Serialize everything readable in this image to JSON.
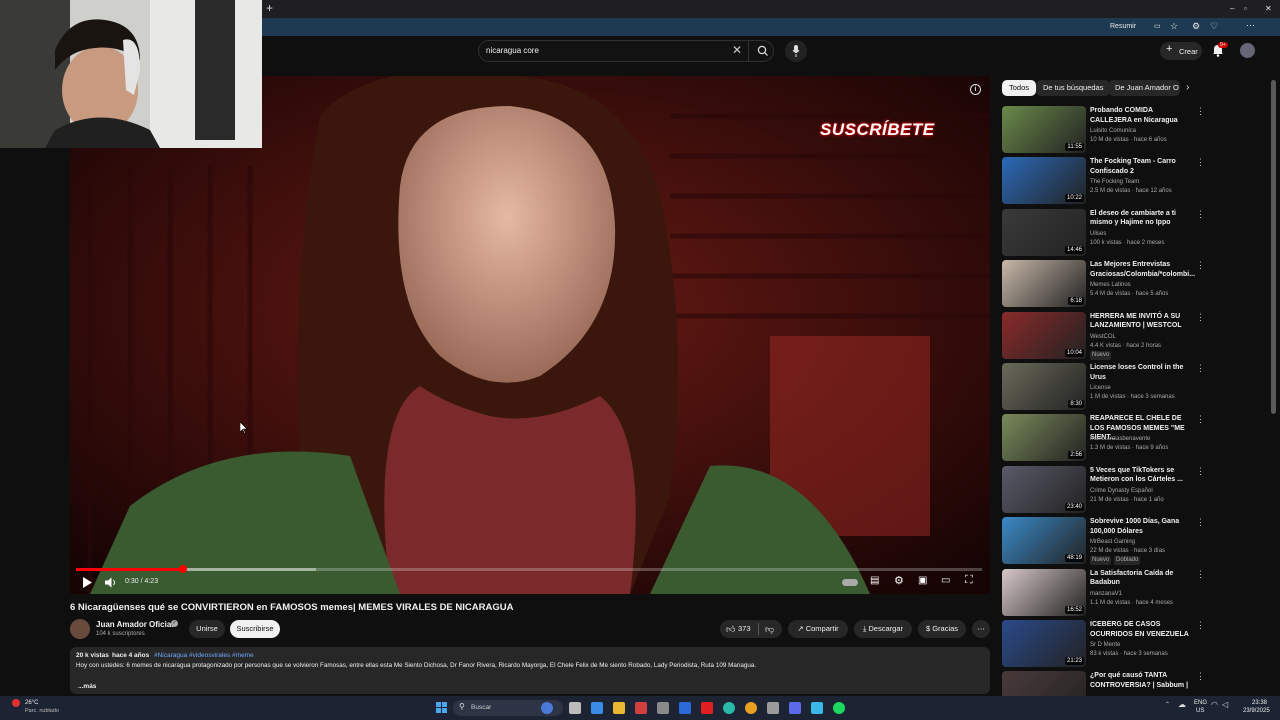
{
  "browser": {
    "new_tab": "+",
    "resume_label": "Resumir",
    "window_controls": [
      "–",
      "▫",
      "✕"
    ]
  },
  "header": {
    "search_query": "nicaragua core",
    "create_label": "Crear",
    "notification_badge": "9+"
  },
  "video": {
    "overlay_text": "SUSCRÍBETE",
    "time": "0:30 / 4:23",
    "progress_fraction": 0.118,
    "buffered_fraction": 0.265
  },
  "meta": {
    "title": "6 Nicaragüenses qué se CONVIRTIERON en FAMOSOS memes| MEMES VIRALES DE NICARAGUA",
    "channel": "Juan Amador Oficial",
    "subs": "104 k suscriptores",
    "join": "Unirse",
    "subscribe": "Suscribirse",
    "likes": "373",
    "share": "Compartir",
    "download": "Descargar",
    "thanks": "Gracias"
  },
  "description": {
    "views": "20 k vistas",
    "age": "hace 4 años",
    "tags": "#Nicaragua #videosvirales #meme",
    "text": "Hoy con ustedes: 6 memes de nicaragua protagonizado por personas que se volvieron Famosas, entre ellas esta Me Siento Dichosa, Dr Fanor Rivera, Ricardo Mayorga, El Chele Felix de Me siento Robado, Lady Periodista, Ruta 109 Managua.",
    "more": "...más"
  },
  "chips": [
    "Todos",
    "De tus búsquedas",
    "De Juan Amador O"
  ],
  "recs": [
    {
      "title": "Probando COMIDA CALLEJERA en Nicaragua",
      "channel": "Luisito Comunica",
      "stats": "10 M de vistas · hace 6 años",
      "dur": "11:55",
      "badge": "",
      "color": "#6a8a4a"
    },
    {
      "title": "The Focking Team - Carro Confiscado 2",
      "channel": "The Focking Team",
      "stats": "2.5 M de vistas · hace 12 años",
      "dur": "10:22",
      "badge": "",
      "color": "#2a6ab8"
    },
    {
      "title": "El deseo de cambiarte a ti mismo y Hajime no Ippo",
      "channel": "Ulises",
      "stats": "100 k vistas · hace 2 meses",
      "dur": "14:46",
      "badge": "",
      "color": "#3a3a3a"
    },
    {
      "title": "Las Mejores Entrevistas Graciosas/Colombia/*colombi...",
      "channel": "Memes Latinos",
      "stats": "5.4 M de vistas · hace 5 años",
      "dur": "6:18",
      "badge": "",
      "color": "#c8b8a8"
    },
    {
      "title": "HERRERA ME INVITÓ A SU LANZAMIENTO | WESTCOL",
      "channel": "WestCOL",
      "stats": "4.4 K vistas · hace 2 horas",
      "dur": "10:04",
      "badge": "Nuevo",
      "color": "#8a2a2a"
    },
    {
      "title": "License loses Control in the Urus",
      "channel": "License",
      "stats": "1 M de vistas · hace 3 semanas",
      "dur": "8:30",
      "badge": "",
      "color": "#6a6a5a"
    },
    {
      "title": "REAPARECE EL CHELE DE LOS FAMOSOS MEMES \"ME SIENT...",
      "channel": "mariolanzasbenavente",
      "stats": "1.3 M de vistas · hace 9 años",
      "dur": "2:56",
      "badge": "",
      "color": "#7a8a5a"
    },
    {
      "title": "5 Veces que TikTokers se Metieron con los Cárteles ...",
      "channel": "Crime Dynasty Español",
      "stats": "21 M de vistas · hace 1 año",
      "dur": "23:40",
      "badge": "",
      "color": "#5a5a6a"
    },
    {
      "title": "Sobrevive 1000 Días, Gana 100,000 Dólares",
      "channel": "MrBeast Gaming",
      "stats": "22 M de vistas · hace 3 días",
      "dur": "48:19",
      "badge": "Nuevo",
      "badge2": "Doblado",
      "color": "#3a8ac8"
    },
    {
      "title": "La Satisfactoria Caída de Badabun",
      "channel": "manzanaV1",
      "stats": "1.1 M de vistas · hace 4 meses",
      "dur": "16:52",
      "badge": "",
      "color": "#d8c8c8"
    },
    {
      "title": "ICEBERG DE CASOS OCURRIDOS EN VENEZUELA",
      "channel": "Sr D Mente",
      "stats": "83 k vistas · hace 3 semanas",
      "dur": "21:23",
      "badge": "",
      "color": "#2a4a8a"
    },
    {
      "title": "¿Por qué causó TANTA CONTROVERSIA? | Sabbum |",
      "channel": "",
      "stats": "",
      "dur": "",
      "badge": "",
      "color": "#4a3a3a"
    }
  ],
  "taskbar": {
    "weather_temp": "26°C",
    "weather_desc": "Parc. nublado",
    "search_label": "Buscar",
    "lang1": "ENG",
    "lang2": "US",
    "time": "23:38",
    "date": "23/9/2025"
  }
}
